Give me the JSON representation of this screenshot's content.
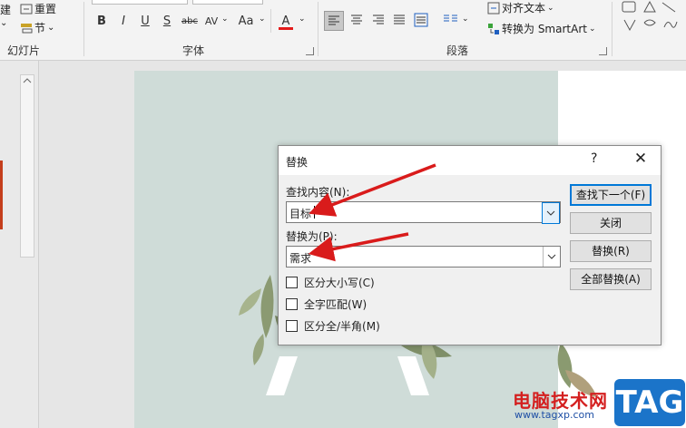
{
  "ribbon": {
    "slides_group": {
      "reset_label": "重置",
      "section_label": "节",
      "section_arrow": "⌄",
      "group_label": "幻灯片",
      "partial_glyph": "建"
    },
    "font_group": {
      "buttons": [
        "B",
        "I",
        "U",
        "S",
        "abc",
        "AV",
        "Aa",
        "A"
      ],
      "group_label": "字体"
    },
    "paragraph_group": {
      "align_text_label": "对齐文本",
      "smartart_label": "转换为 SmartArt",
      "group_label": "段落"
    },
    "colors": {
      "font_color_bar": "#e31b1b",
      "accent_marker": "#c43e1c"
    }
  },
  "dialog": {
    "title": "替换",
    "help": "?",
    "close": "✕",
    "find_label": "查找内容(N):",
    "find_value": "目标",
    "replace_label": "替换为(P):",
    "replace_value": "需求",
    "buttons": {
      "find_next": "查找下一个(F)",
      "close": "关闭",
      "replace": "替换(R)",
      "replace_all": "全部替换(A)"
    },
    "options": [
      {
        "label": "区分大小写(C)",
        "checked": false
      },
      {
        "label": "全字匹配(W)",
        "checked": false
      },
      {
        "label": "区分全/半角(M)",
        "checked": false
      }
    ]
  },
  "watermark": {
    "text": "电脑技术网",
    "url": "www.tagxp.com",
    "badge": "TAG"
  }
}
